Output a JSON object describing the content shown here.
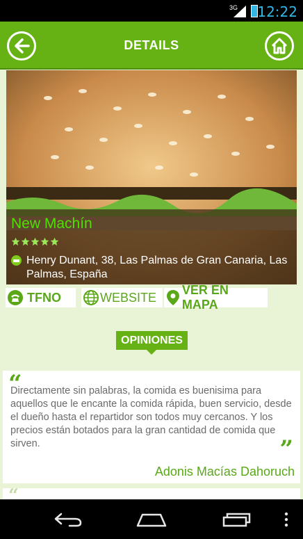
{
  "status_bar": {
    "network": "3G",
    "time": "12:22"
  },
  "app_bar": {
    "title": "DETAILS"
  },
  "place": {
    "name": "New Machín",
    "rating_stars": 5,
    "address": "Henry Dunant, 38, Las Palmas de Gran Canaria, Las Palmas, España"
  },
  "actions": {
    "phone_label": "TFNO",
    "website_label": "WEBSITE",
    "map_label": "VER EN MAPA"
  },
  "opinions": {
    "header": "OPINIONES",
    "reviews": [
      {
        "text": "Directamente sin palabras, la comida es buenisima para aquellos que le encante la comida rápida, buen servicio, desde el dueño hasta el repartidor son todos muy cercanos. Y los precios están botados para la gran cantidad de comida que sirven.",
        "author": "Adonis Macías Dahoruch"
      }
    ]
  },
  "colors": {
    "accent": "#66b214",
    "name": "#4fe000",
    "background": "#e9f3d6"
  },
  "icons": [
    "back-arrow-icon",
    "home-icon",
    "star-icon",
    "address-icon",
    "phone-icon",
    "globe-icon",
    "map-pin-icon",
    "nav-back-icon",
    "nav-home-icon",
    "nav-recents-icon",
    "overflow-menu-icon"
  ]
}
